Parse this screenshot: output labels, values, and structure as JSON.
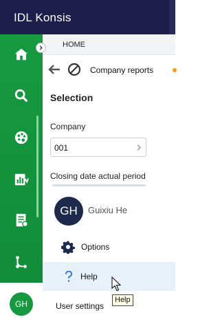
{
  "app": {
    "title": "IDL Konsis"
  },
  "tabs": [
    {
      "label": "HOME"
    }
  ],
  "nav": {
    "breadcrumb": "Company reports"
  },
  "rail": {
    "items": [
      {
        "icon": "home-icon"
      },
      {
        "icon": "search-icon"
      },
      {
        "icon": "palette-icon"
      },
      {
        "icon": "report-chart-icon"
      },
      {
        "icon": "document-list-icon"
      },
      {
        "icon": "workflow-icon"
      }
    ],
    "avatar_initials": "GH"
  },
  "selection": {
    "title": "Selection",
    "company_label": "Company",
    "company_value": "001",
    "closing_label": "Closing date actual period"
  },
  "user_menu": {
    "initials": "GH",
    "name": "Guixiu He",
    "items": [
      {
        "label": "Options",
        "icon": "gear-icon"
      },
      {
        "label": "Help",
        "icon": "question-icon"
      },
      {
        "label": "User settings"
      }
    ]
  },
  "tooltip": {
    "text": "Help"
  },
  "colors": {
    "titlebar": "#1e1e4c",
    "rail": "#179a3f",
    "avatar_dark": "#1e2a4c",
    "hover": "#e8f1f9",
    "accent_dot": "#f39c12"
  }
}
